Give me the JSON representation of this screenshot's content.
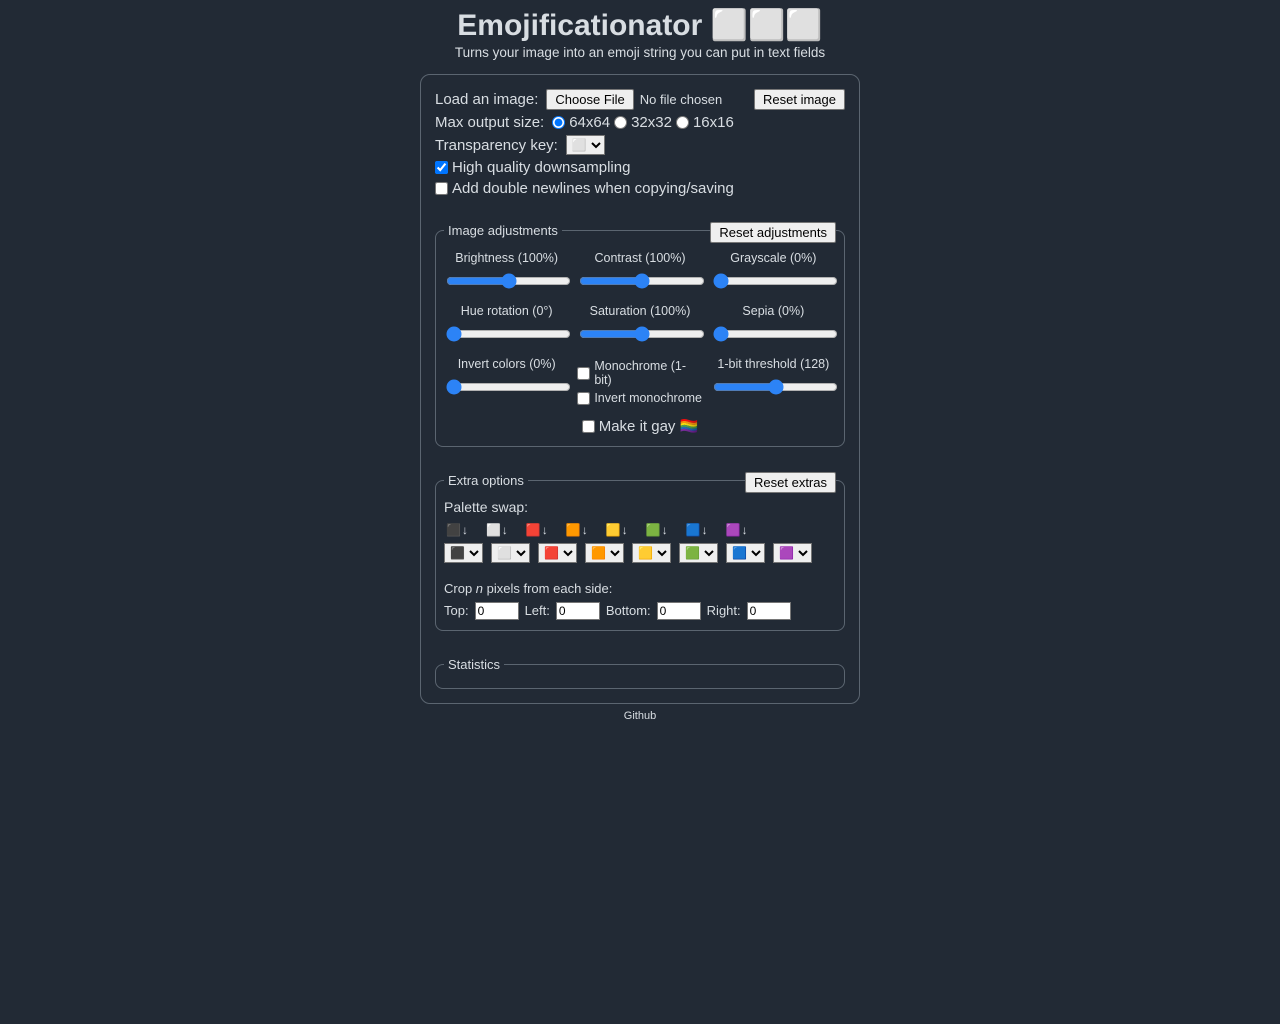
{
  "header": {
    "title": "Emojificationator ⬜⬜⬜",
    "subtitle": "Turns your image into an emoji string you can put in text fields"
  },
  "top": {
    "load_label": "Load an image:",
    "choose_file": "Choose File",
    "file_status": "No file chosen",
    "reset_image": "Reset image",
    "max_output_label": "Max output size:",
    "opt_64": "64x64",
    "opt_32": "32x32",
    "opt_16": "16x16",
    "transparency_label": "Transparency key:",
    "transparency_value": "⬜",
    "hq_label": "High quality downsampling",
    "double_nl_label": "Add double newlines when copying/saving"
  },
  "adjust": {
    "legend": "Image adjustments",
    "reset": "Reset adjustments",
    "brightness_label": "Brightness (100%)",
    "brightness_val": 100,
    "contrast_label": "Contrast (100%)",
    "contrast_val": 100,
    "grayscale_label": "Grayscale (0%)",
    "grayscale_val": 0,
    "hue_label": "Hue rotation (0°)",
    "hue_val": 0,
    "saturation_label": "Saturation (100%)",
    "saturation_val": 100,
    "sepia_label": "Sepia (0%)",
    "sepia_val": 0,
    "invert_label": "Invert colors (0%)",
    "invert_val": 0,
    "mono_label": "Monochrome (1-bit)",
    "invert_mono_label": "Invert monochrome",
    "threshold_label": "1-bit threshold (128)",
    "threshold_val": 128,
    "gay_label": "Make it gay 🏳️‍🌈"
  },
  "extras": {
    "legend": "Extra options",
    "reset": "Reset extras",
    "palette_label": "Palette swap:",
    "arrow": "↓",
    "swap_emojis": [
      "⬛",
      "⬜",
      "🟥",
      "🟧",
      "🟨",
      "🟩",
      "🟦",
      "🟪"
    ],
    "crop_prefix": "Crop ",
    "crop_n": "n",
    "crop_suffix": " pixels from each side:",
    "top": "Top:",
    "left": "Left:",
    "bottom": "Bottom:",
    "right": "Right:",
    "crop_val": "0"
  },
  "stats": {
    "legend": "Statistics"
  },
  "footer": {
    "github": "Github"
  }
}
